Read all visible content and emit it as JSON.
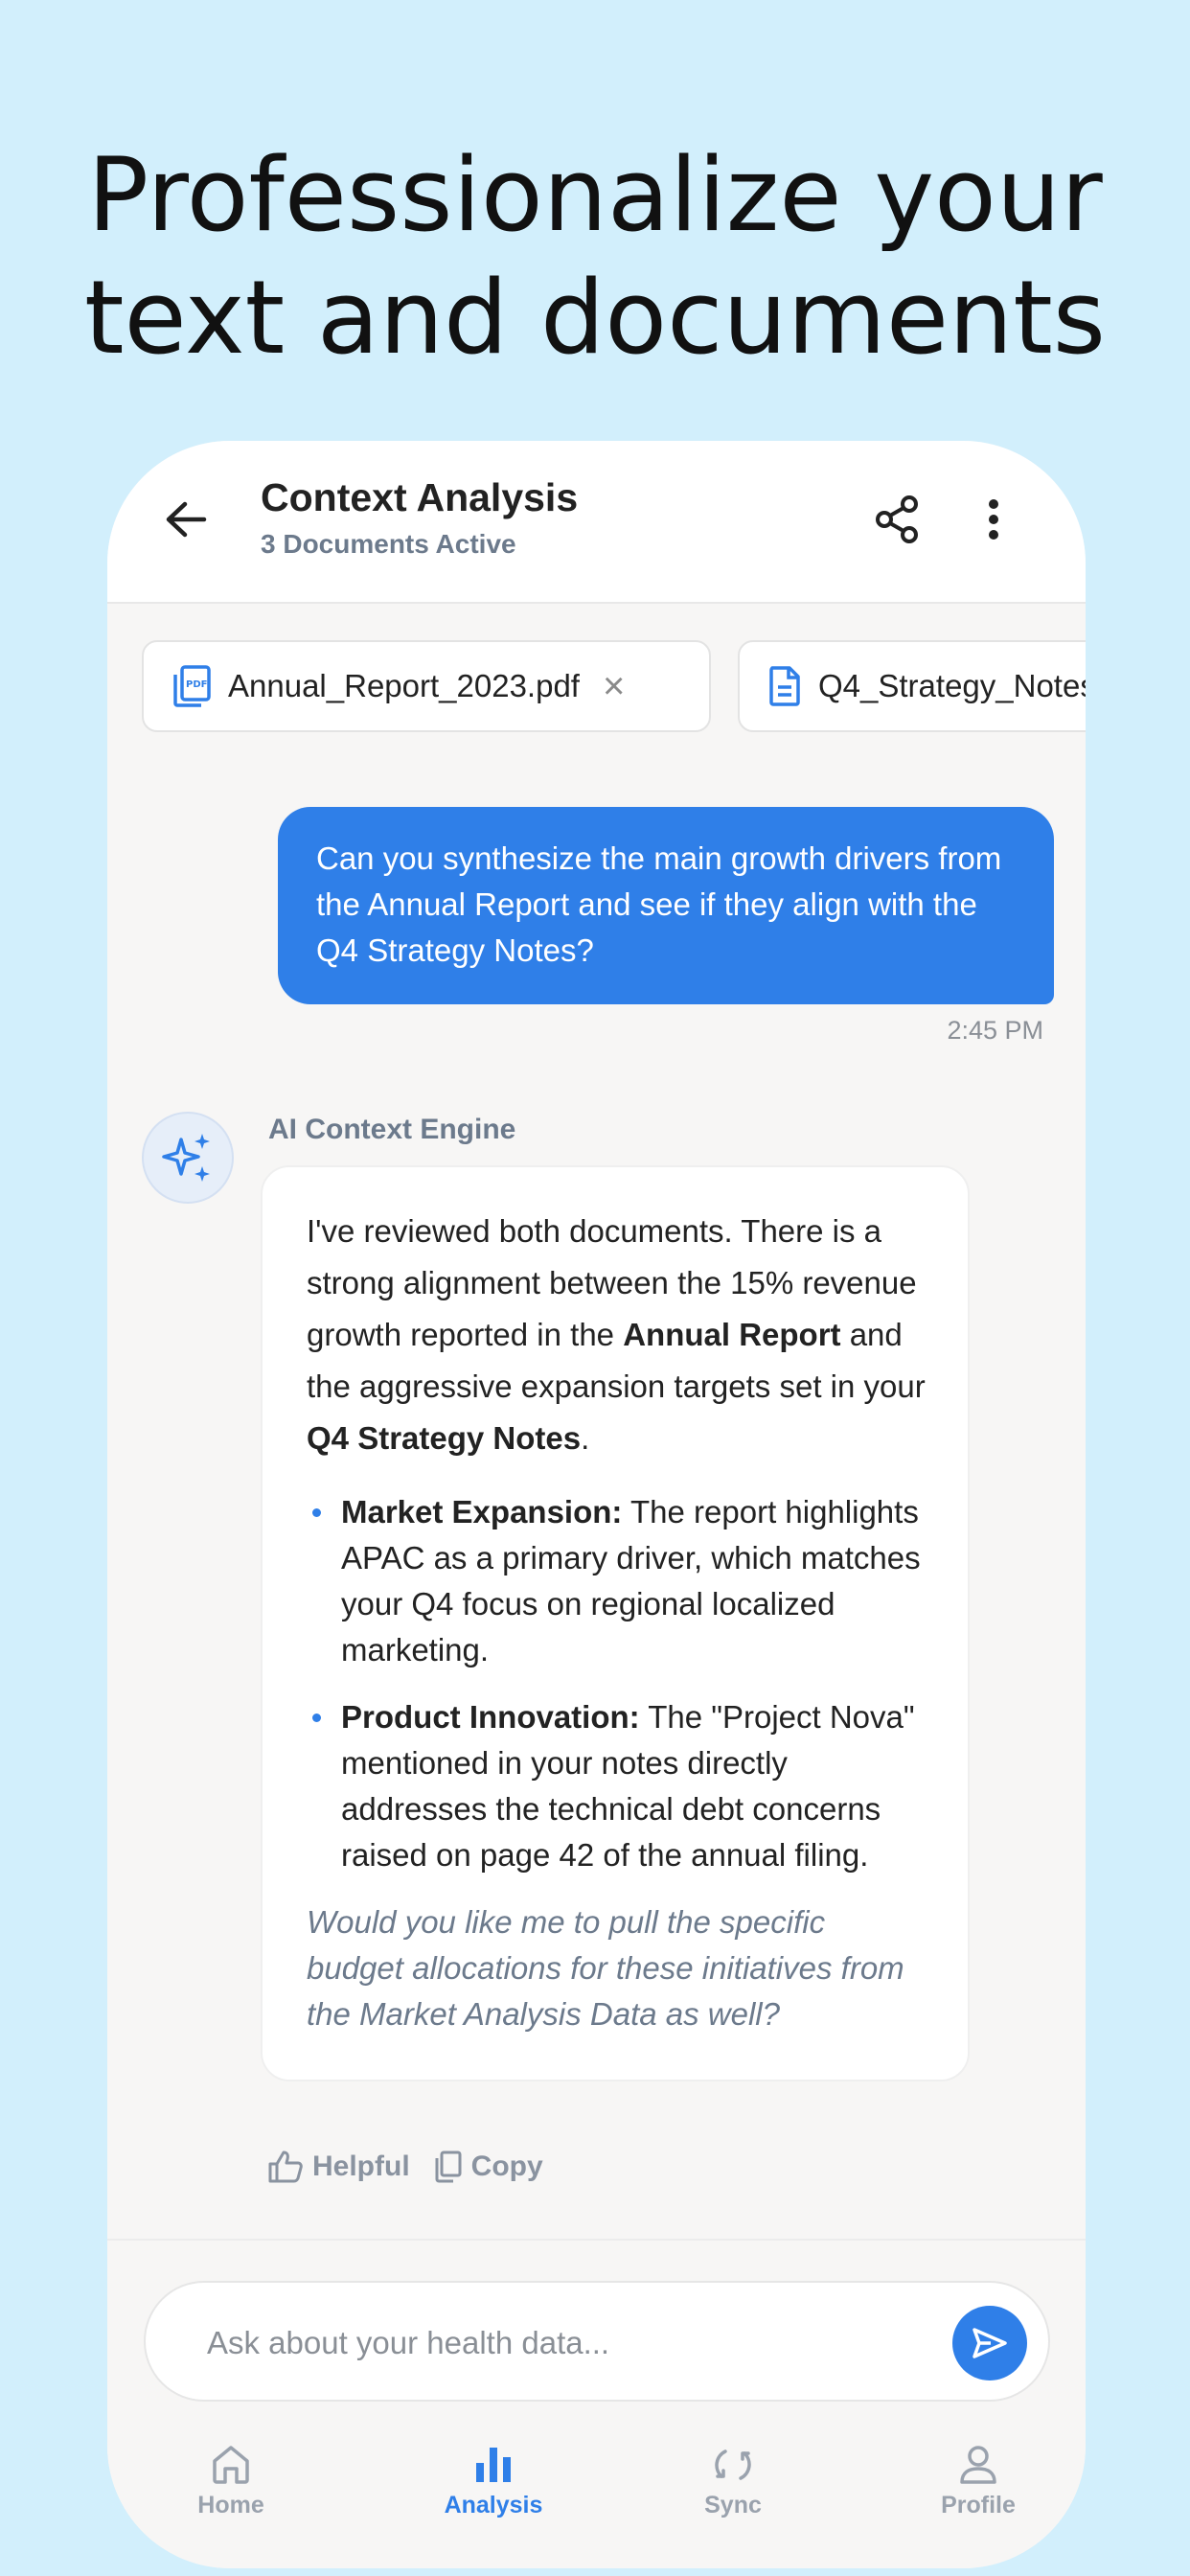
{
  "headline": {
    "line1": "Professionalize your",
    "line2": "text and documents"
  },
  "header": {
    "title": "Context Analysis",
    "subtitle": "3 Documents Active",
    "back_icon": "arrow-left-icon",
    "share_icon": "share-icon",
    "more_icon": "more-vertical-icon"
  },
  "documents": [
    {
      "name": "Annual_Report_2023.pdf",
      "icon": "pdf-file-icon",
      "removable": true
    },
    {
      "name": "Q4_Strategy_Notes",
      "icon": "document-icon",
      "removable": false
    }
  ],
  "user_message": {
    "text": "Can you synthesize the main growth drivers from the Annual Report and see if they align with the Q4 Strategy Notes?",
    "time": "2:45 PM"
  },
  "ai_message": {
    "sender": "AI Context Engine",
    "avatar_icon": "sparkles-icon",
    "intro_part1": "I've reviewed both documents. There is a strong alignment between the 15% revenue growth reported in the ",
    "intro_bold1": "Annual Report",
    "intro_part2": " and the aggressive expansion targets set in your ",
    "intro_bold2": "Q4 Strategy Notes",
    "intro_part3": ".",
    "bullets": [
      {
        "title": "Market Expansion:",
        "text": " The report highlights APAC as a primary driver, which matches your Q4 focus on regional localized marketing."
      },
      {
        "title": "Product Innovation:",
        "text": " The \"Project Nova\" mentioned in your notes directly addresses the technical debt concerns raised on page 42 of the annual filing."
      }
    ],
    "followup": "Would you like me to pull the specific budget allocations for these initiatives from the Market Analysis Data as well?",
    "actions": {
      "helpful_label": "Helpful",
      "copy_label": "Copy"
    }
  },
  "composer": {
    "placeholder": "Ask about your health data...",
    "send_icon": "send-icon"
  },
  "nav": [
    {
      "label": "Home",
      "icon": "home-icon",
      "active": false
    },
    {
      "label": "Analysis",
      "icon": "bar-chart-icon",
      "active": true
    },
    {
      "label": "Sync",
      "icon": "sync-icon",
      "active": false
    },
    {
      "label": "Profile",
      "icon": "user-icon",
      "active": false
    }
  ],
  "colors": {
    "accent": "#2f7fe8",
    "background": "#d2effc",
    "muted_text": "#6c7a8c"
  }
}
